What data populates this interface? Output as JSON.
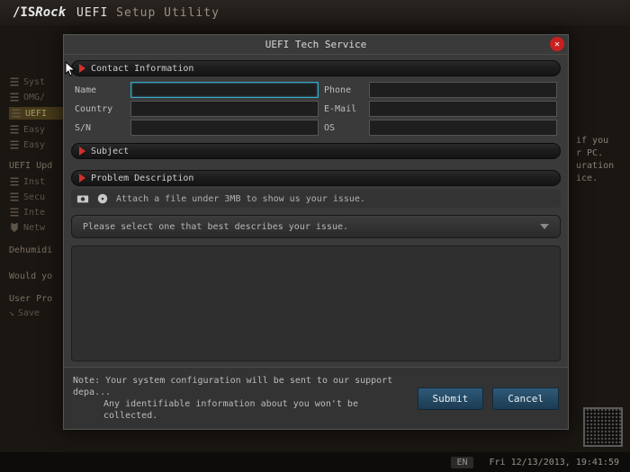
{
  "header": {
    "brand_left": "/IS",
    "brand_right": "Rock",
    "uefi": "UEFI",
    "setup": "Setup Utility"
  },
  "sidebar": {
    "items": [
      {
        "label": "Syst"
      },
      {
        "label": "OMG/"
      },
      {
        "label": "UEFI"
      },
      {
        "label": "Easy"
      },
      {
        "label": "Easy"
      }
    ],
    "upd": "UEFI Upd",
    "items2": [
      {
        "label": "Inst"
      },
      {
        "label": "Secu"
      },
      {
        "label": "Inte"
      },
      {
        "label": "Netw"
      }
    ],
    "dehum": "Dehumidi",
    "would": "Would yo",
    "user": "User Pro",
    "save": "Save"
  },
  "right_panel": {
    "l1": "if you",
    "l2": "r PC.",
    "l3": "uration",
    "l4": "ice."
  },
  "modal": {
    "title": "UEFI Tech Service",
    "close": "✕",
    "contact_hdr": "Contact Information",
    "fields": {
      "name": "Name",
      "phone": "Phone",
      "country": "Country",
      "email": "E-Mail",
      "sn": "S/N",
      "os": "OS"
    },
    "subject_hdr": "Subject",
    "problem_hdr": "Problem Description",
    "attach_hint": "Attach a file under 3MB to show us your issue.",
    "dropdown_placeholder": "Please select one that best describes your issue.",
    "note_l1": "Note: Your system configuration will be sent to our support depa...",
    "note_l2": "Any identifiable information about you won't be collected.",
    "submit": "Submit",
    "cancel": "Cancel"
  },
  "status": {
    "lang": "EN",
    "datetime": "Fri 12/13/2013, 19:41:59"
  }
}
